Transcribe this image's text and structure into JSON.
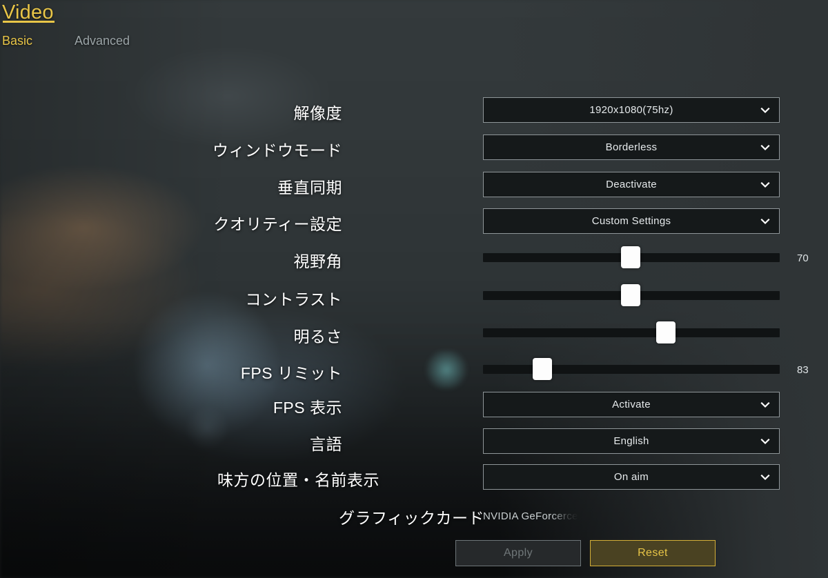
{
  "header": {
    "title": "Video",
    "tabs": [
      {
        "label": "Basic",
        "active": true
      },
      {
        "label": "Advanced",
        "active": false
      }
    ]
  },
  "colors": {
    "accent_gold": "#e8c547",
    "reset_border": "#d4af37",
    "reset_fill": "#4a4222",
    "panel_bg": "#2f3436",
    "field_bg": "#15191a",
    "field_border": "#8f9699",
    "text_primary": "#ffffff",
    "text_muted": "#9aa3a6",
    "disabled_text": "#707779"
  },
  "settings": {
    "resolution": {
      "label": "解像度",
      "value": "1920x1080(75hz)",
      "type": "select"
    },
    "window_mode": {
      "label": "ウィンドウモード",
      "value": "Borderless",
      "type": "select"
    },
    "vsync": {
      "label": "垂直同期",
      "value": "Deactivate",
      "type": "select"
    },
    "quality_preset": {
      "label": "クオリティー設定",
      "value": "Custom Settings",
      "type": "select"
    },
    "fov": {
      "label": "視野角",
      "value": "70",
      "type": "slider",
      "percent": 50
    },
    "contrast": {
      "label": "コントラスト",
      "value": "",
      "type": "slider",
      "percent": 50
    },
    "brightness": {
      "label": "明るさ",
      "value": "",
      "type": "slider",
      "percent": 62
    },
    "fps_limit": {
      "label": "FPS リミット",
      "value": "83",
      "type": "slider",
      "percent": 20
    },
    "fps_display": {
      "label": "FPS 表示",
      "value": "Activate",
      "type": "select"
    },
    "language": {
      "label": "言語",
      "value": "English",
      "type": "select"
    },
    "teammate_display": {
      "label": "味方の位置・名前表示",
      "value": "On aim",
      "type": "select"
    },
    "graphics_card": {
      "label": "グラフィックカード",
      "value": "NVIDIA GeForcerce",
      "type": "text"
    }
  },
  "footer": {
    "apply_label": "Apply",
    "reset_label": "Reset",
    "apply_enabled": false
  }
}
